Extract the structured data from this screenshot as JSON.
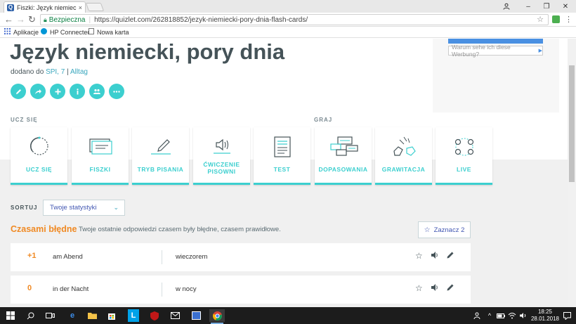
{
  "browser": {
    "tab_title": "Fiszki: Język niemiecki, p",
    "tab_close": "×",
    "favicon": "Q",
    "security_label": "Bezpieczna",
    "url": "https://quizlet.com/262818852/jezyk-niemiecki-pory-dnia-flash-cards/",
    "window_controls": {
      "minimize": "–",
      "restore": "❐",
      "close": "✕"
    }
  },
  "bookmarks": [
    {
      "label": "Aplikacje",
      "icon": "apps-grid-icon"
    },
    {
      "label": "HP Connected",
      "icon": "hp-logo-icon"
    },
    {
      "label": "Nowa karta",
      "icon": "page-icon"
    }
  ],
  "set": {
    "title": "Język niemiecki, pory dnia",
    "added_prefix": "dodano do",
    "folder": "SPI, 7",
    "separator": "|",
    "category": "Alltag"
  },
  "ad": {
    "why_label": "Warum sehe ich diese Werbung?"
  },
  "sections": {
    "study": "UCZ SIĘ",
    "play": "GRAJ"
  },
  "modes": [
    {
      "label": "UCZ SIĘ",
      "icon": "learn-circle-icon"
    },
    {
      "label": "FISZKI",
      "icon": "flashcards-icon"
    },
    {
      "label": "TRYB PISANIA",
      "icon": "pencil-write-icon"
    },
    {
      "label": "ĆWICZENIE PISOWNI",
      "icon": "speaker-spell-icon"
    },
    {
      "label": "TEST",
      "icon": "test-document-icon"
    },
    {
      "label": "DOPASOWANIA",
      "icon": "match-icon"
    },
    {
      "label": "GRAWITACJA",
      "icon": "gravity-icon"
    },
    {
      "label": "LIVE",
      "icon": "live-icon"
    }
  ],
  "sort": {
    "label": "SORTUJ",
    "selected": "Twoje statystyki"
  },
  "wrong": {
    "title": "Czasami błędne",
    "description": "Twoje ostatnie odpowiedzi czasem były błędne, czasem prawidłowe.",
    "mark_button": "Zaznacz 2"
  },
  "cards": [
    {
      "score": "+1",
      "term": "am Abend",
      "definition": "wieczorem"
    },
    {
      "score": "0",
      "term": "in der Nacht",
      "definition": "w nocy"
    }
  ],
  "taskbar": {
    "time": "18:25",
    "date": "28.01.2018"
  },
  "colors": {
    "accent": "#3ccfcf",
    "warning": "#f08a24",
    "link": "#4257b2"
  }
}
